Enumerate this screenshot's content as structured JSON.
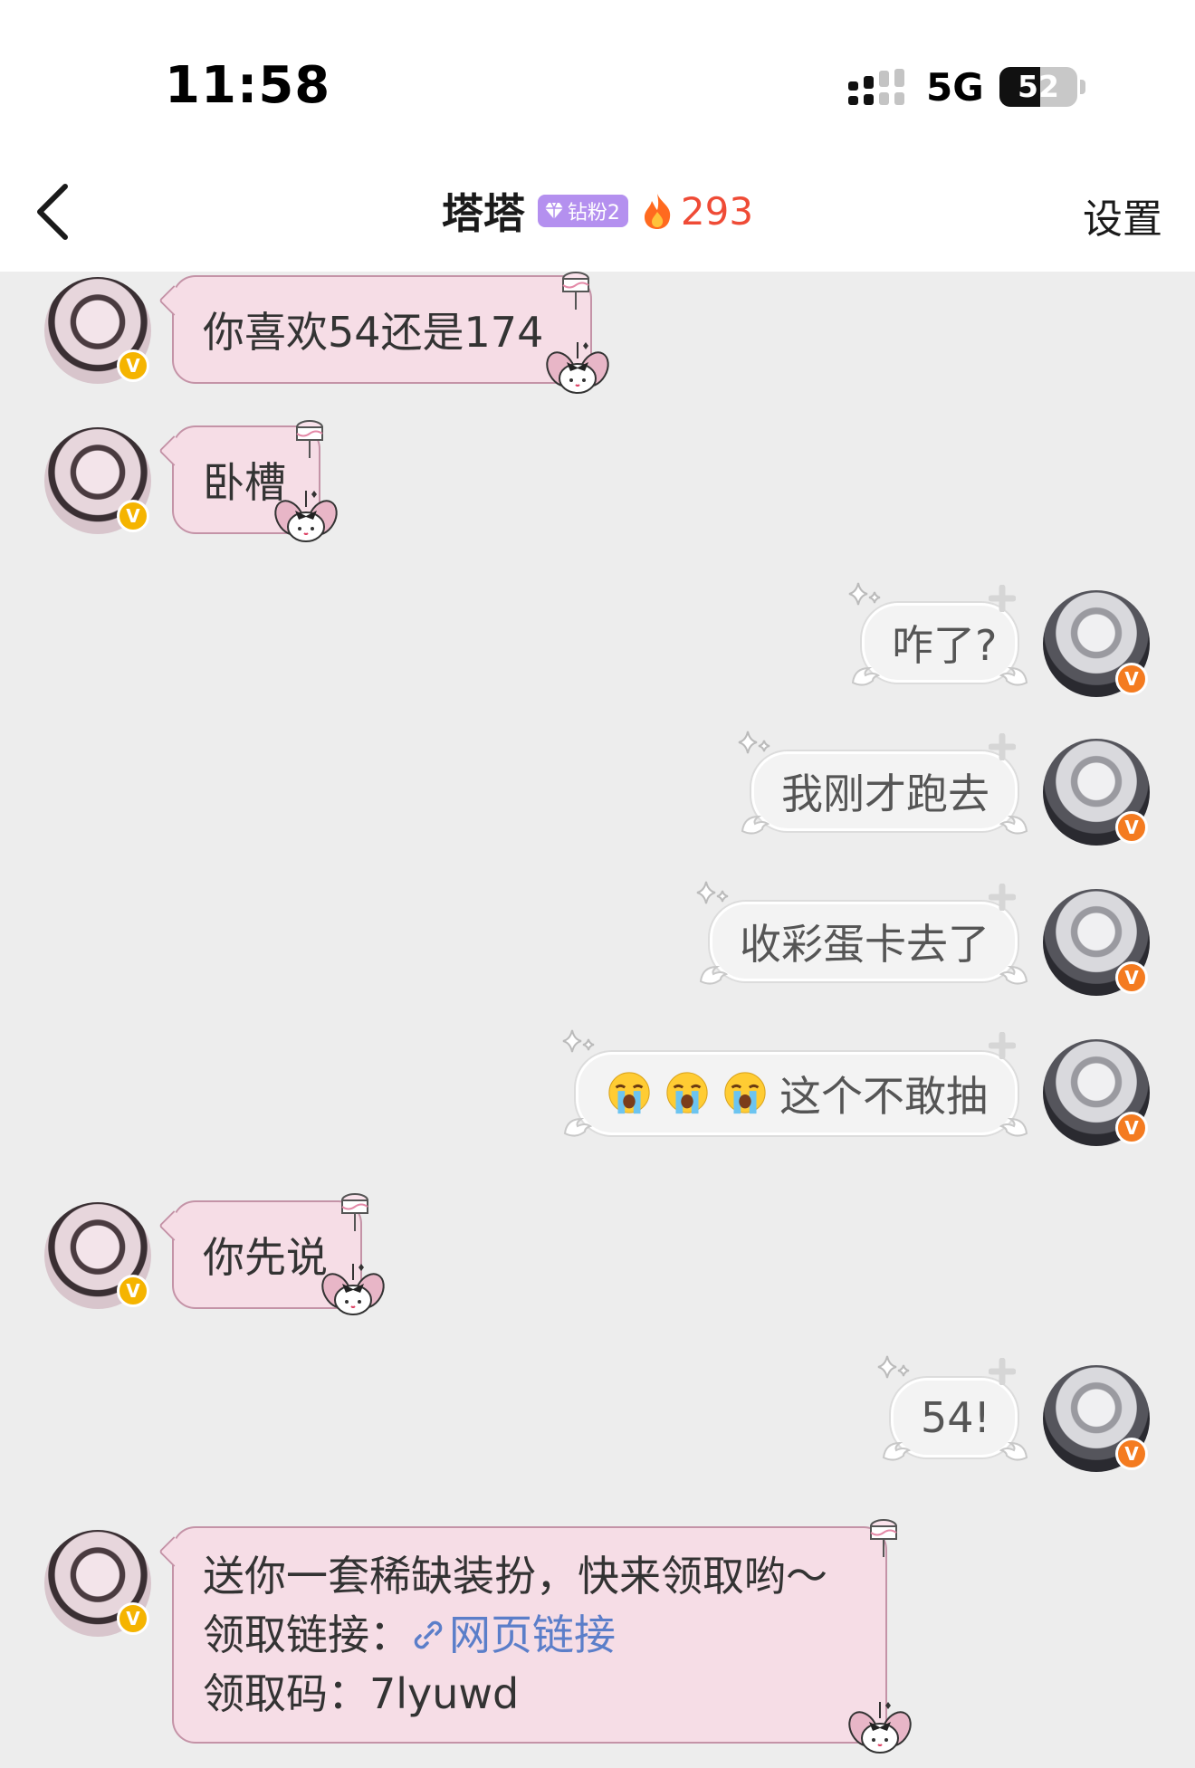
{
  "status_bar": {
    "time": "11:58",
    "network": "5G",
    "battery": "52",
    "battery_level": 0.52
  },
  "header": {
    "title": "塔塔",
    "fan_badge": "钻粉2",
    "intimacy": "293",
    "settings_label": "设置"
  },
  "messages": [
    {
      "side": "left",
      "text": "你喜欢54还是174"
    },
    {
      "side": "left",
      "text": "卧槽"
    },
    {
      "side": "right",
      "text": "咋了?"
    },
    {
      "side": "right",
      "text": "我刚才跑去"
    },
    {
      "side": "right",
      "text": "收彩蛋卡去了"
    },
    {
      "side": "right",
      "text": "这个不敢抽",
      "emoji": [
        "crying-face",
        "crying-face",
        "crying-face"
      ]
    },
    {
      "side": "left",
      "text": "你先说"
    },
    {
      "side": "right",
      "text": "54!"
    },
    {
      "side": "left",
      "line1": "送你一套稀缺装扮，快来领取哟～",
      "line2_label": "领取链接：",
      "link_text": "网页链接",
      "line3": "领取码：7lyuwd"
    }
  ],
  "colors": {
    "left_bubble": "#f6dde6",
    "left_bubble_border": "#c493a7",
    "right_bubble": "#f3f3f3",
    "link": "#5b7ec9",
    "intimacy": "#ef4b36",
    "fan_badge": "#b490ef"
  }
}
